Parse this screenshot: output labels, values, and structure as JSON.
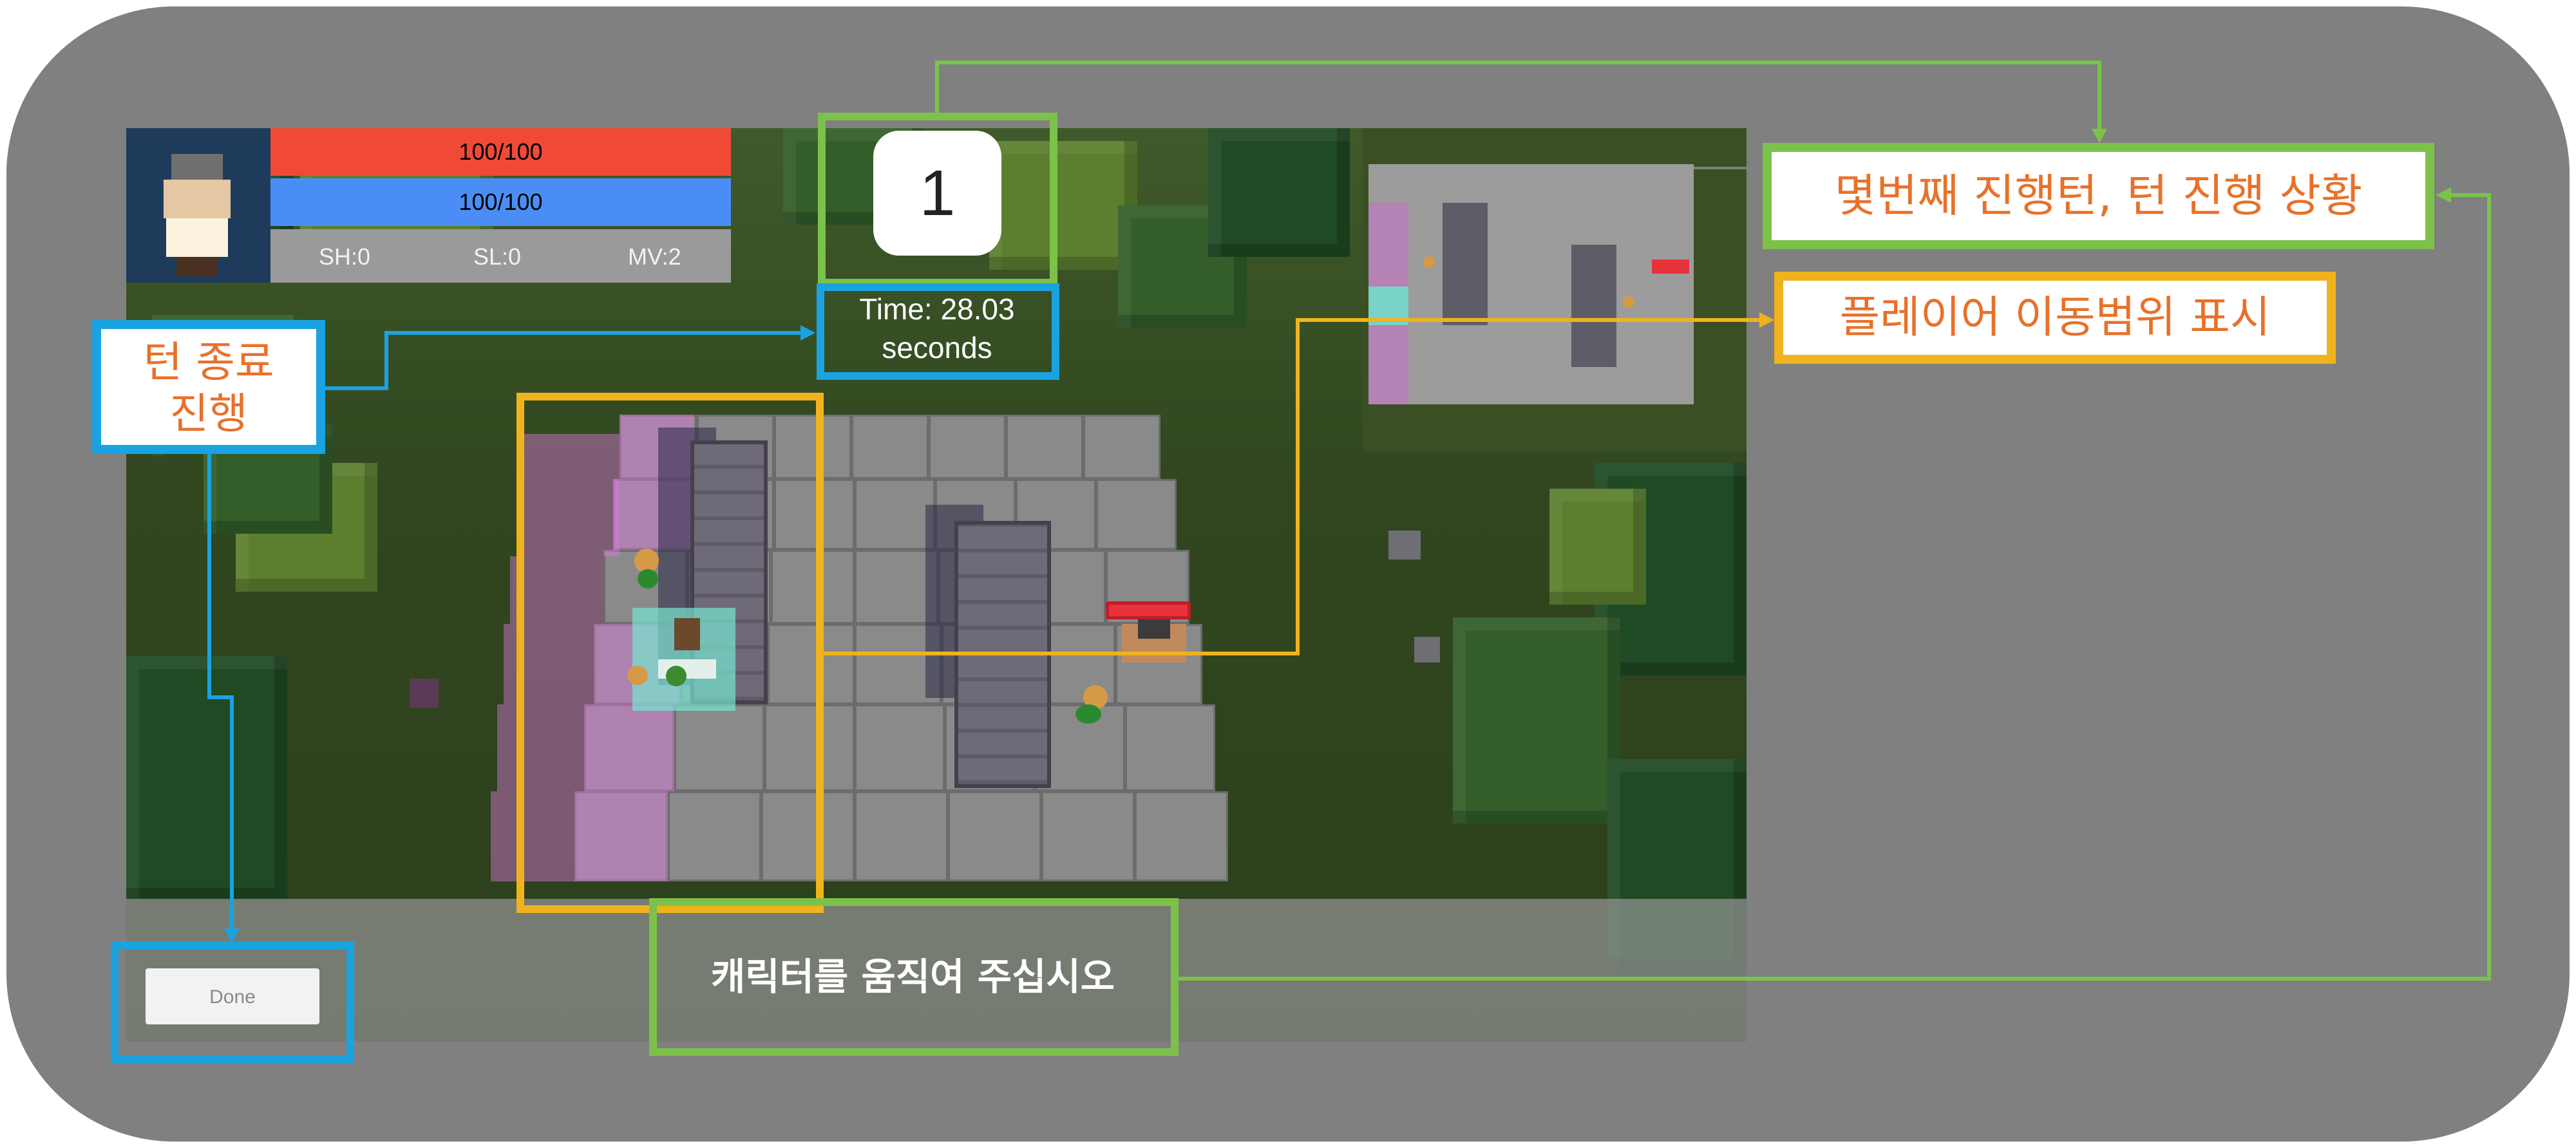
{
  "hud": {
    "hp": "100/100",
    "mp": "100/100",
    "stats": {
      "sh": "SH:0",
      "sl": "SL:0",
      "mv": "MV:2"
    },
    "colors": {
      "hp": "#f04a36",
      "mp": "#4a8ef5"
    }
  },
  "turn": {
    "number": "1"
  },
  "timer": {
    "line1": "Time: 28.03",
    "line2": "seconds"
  },
  "done_button": {
    "label": "Done"
  },
  "instruction": {
    "text": "캐릭터를 움직여 주십시오"
  },
  "annotations": {
    "turn_status": "몇번째 진행턴, 턴 진행 상황",
    "move_range": "플레이어 이동범위 표시",
    "end_turn_line1": "턴 종료",
    "end_turn_line2": "진행"
  },
  "colors": {
    "green": "#7cc24a",
    "blue": "#1aa3e0",
    "yellow": "#f0b31e",
    "callout_text": "#e8712a",
    "frame": "#808080"
  },
  "icons": [
    "player-portrait-icon",
    "player-character-icon",
    "enemy-character-icon",
    "ally-character-icon"
  ]
}
